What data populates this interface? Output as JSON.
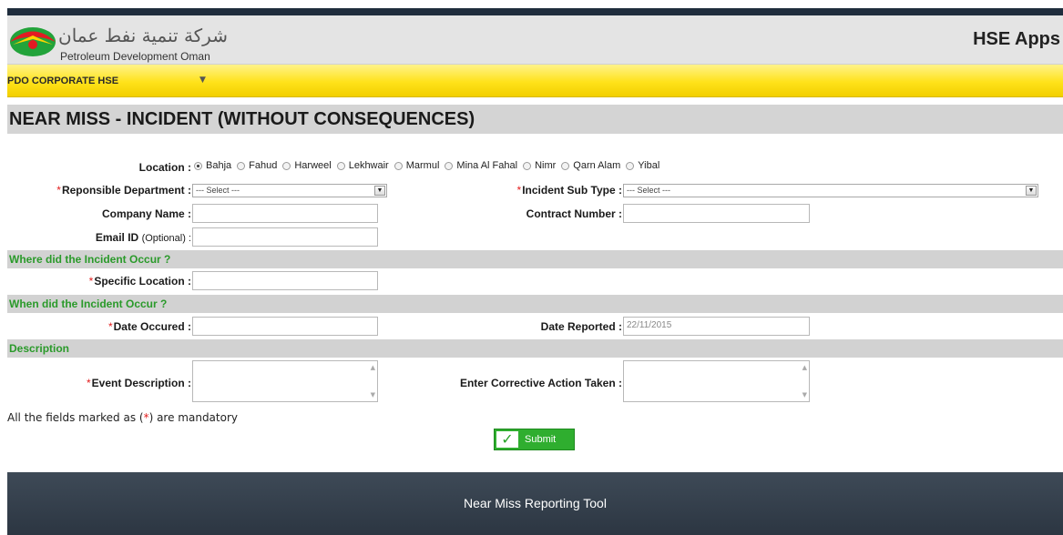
{
  "header": {
    "logo_arabic": "شركة تنمية نفط عمان",
    "logo_english": "Petroleum Development Oman",
    "app_name": "HSE Apps"
  },
  "nav": {
    "menu_label": "PDO CORPORATE HSE",
    "caret": "▼"
  },
  "page_title": "NEAR MISS - INCIDENT (WITHOUT CONSEQUENCES)",
  "location": {
    "label": "Location :",
    "selected": "Bahja",
    "options": [
      "Bahja",
      "Fahud",
      "Harweel",
      "Lekhwair",
      "Marmul",
      "Mina Al Fahal",
      "Nimr",
      "Qarn Alam",
      "Yibal"
    ]
  },
  "fields": {
    "department": {
      "label": "Reponsible Department :",
      "value": "--- Select ---"
    },
    "sub_type": {
      "label": "Incident Sub Type :",
      "value": "--- Select ---"
    },
    "company_name": {
      "label": "Company Name :",
      "value": ""
    },
    "contract_number": {
      "label": "Contract Number :",
      "value": ""
    },
    "email": {
      "label": "Email ID",
      "optional": "(Optional) :",
      "value": ""
    },
    "specific_location": {
      "label": "Specific Location :",
      "value": ""
    },
    "date_occured": {
      "label": "Date Occured :",
      "value": ""
    },
    "date_reported": {
      "label": "Date Reported :",
      "value": "22/11/2015"
    },
    "event_description": {
      "label": "Event Description :",
      "value": ""
    },
    "corrective_action": {
      "label": "Enter Corrective Action Taken :",
      "value": ""
    }
  },
  "sections": {
    "where": "Where did the Incident Occur ?",
    "when": "When did the Incident Occur ?",
    "description": "Description"
  },
  "required_marker": "*",
  "note": {
    "before": "All the fields marked as (",
    "star": "*",
    "after": ") are mandatory"
  },
  "submit_label": "Submit",
  "footer_text": "Near Miss Reporting Tool",
  "colors": {
    "nav_yellow": "#ffe21a",
    "section_green": "#2a9a2a",
    "required_red": "#e31c1c",
    "submit_green": "#2fae2f",
    "footer_dark": "#323d4a"
  }
}
